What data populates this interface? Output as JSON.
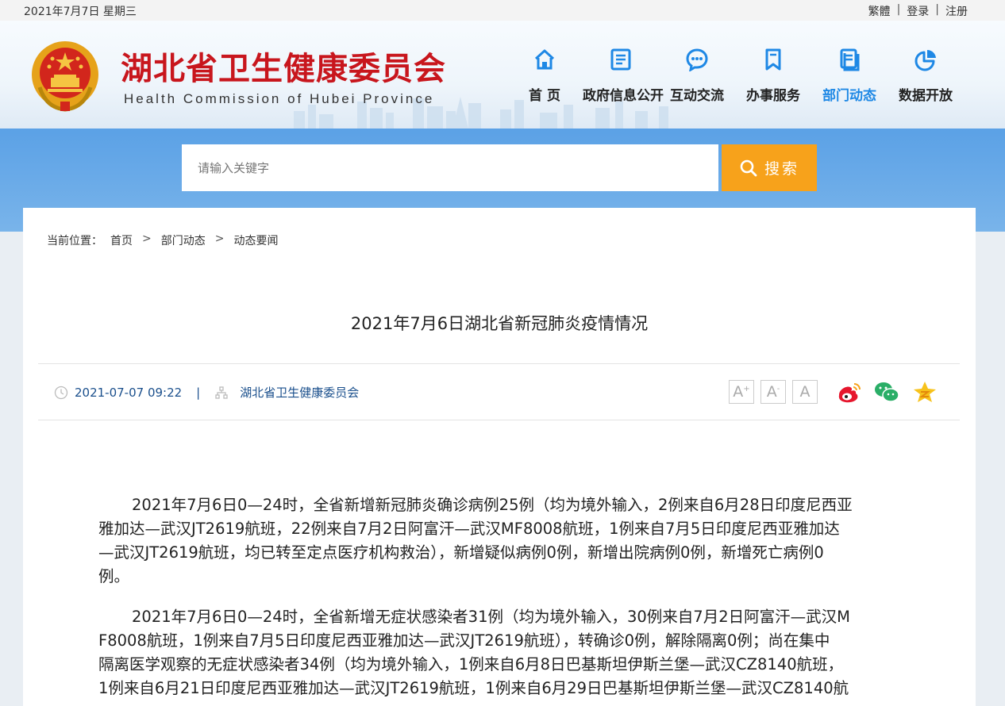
{
  "topbar": {
    "date": "2021年7月7日 星期三",
    "traditional": "繁體",
    "login": "登录",
    "register": "注册",
    "sep": "|"
  },
  "header": {
    "title": "湖北省卫生健康委员会",
    "subtitle": "Health Commission of Hubei Province"
  },
  "nav": [
    {
      "label": "首  页",
      "icon": "home-icon"
    },
    {
      "label": "政府信息公开",
      "icon": "document-icon"
    },
    {
      "label": "互动交流",
      "icon": "chat-icon"
    },
    {
      "label": "办事服务",
      "icon": "bookmark-icon"
    },
    {
      "label": "部门动态",
      "icon": "news-icon",
      "active": true
    },
    {
      "label": "数据开放",
      "icon": "pie-chart-icon"
    }
  ],
  "search": {
    "placeholder": "请输入关键字",
    "button": "搜索"
  },
  "breadcrumb": {
    "prefix": "当前位置：",
    "items": [
      "首页",
      "部门动态",
      "动态要闻"
    ],
    "arrow": ">"
  },
  "article": {
    "title": "2021年7月6日湖北省新冠肺炎疫情情况",
    "datetime": "2021-07-07 09:22",
    "divider": "|",
    "source": "湖北省卫生健康委员会",
    "font_buttons": [
      "A",
      "A",
      "A"
    ],
    "paragraphs": [
      [
        "2021年7月6日0—24时，全省新增新冠肺炎确诊病例25例（均为境外输入，2例来自6月28日印度尼西亚",
        "雅加达—武汉JT2619航班，22例来自7月2日阿富汗—武汉MF8008航班，1例来自7月5日印度尼西亚雅加达",
        "—武汉JT2619航班，均已转至定点医疗机构救治），新增疑似病例0例，新增出院病例0例，新增死亡病例0",
        "例。"
      ],
      [
        "2021年7月6日0—24时，全省新增无症状感染者31例（均为境外输入，30例来自7月2日阿富汗—武汉M",
        "F8008航班，1例来自7月5日印度尼西亚雅加达—武汉JT2619航班），转确诊0例，解除隔离0例；尚在集中",
        "隔离医学观察的无症状感染者34例（均为境外输入，1例来自6月8日巴基斯坦伊斯兰堡—武汉CZ8140航班，",
        "1例来自6月21日印度尼西亚雅加达—武汉JT2619航班，1例来自6月29日巴基斯坦伊斯兰堡—武汉CZ8140航"
      ]
    ]
  },
  "colors": {
    "brand_red": "#c8161d",
    "accent_blue": "#1e88e5",
    "search_orange": "#f7a21b"
  }
}
